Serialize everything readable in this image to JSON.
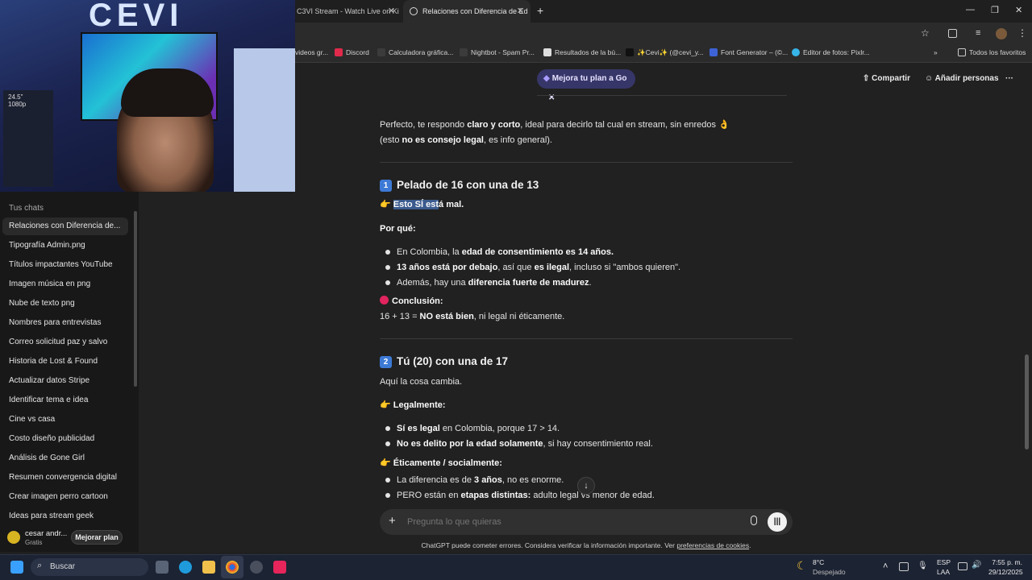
{
  "browser": {
    "tabs": [
      {
        "title": "C3VI Stream - Watch Live on Ki"
      },
      {
        "title": "Relaciones con Diferencia de Ed"
      }
    ],
    "new_tab": "+",
    "bookmarks": [
      "videos gr...",
      "Discord",
      "Calculadora gráfica...",
      "Nightbot - Spam Pr...",
      "Resultados de la bú...",
      "✨Cevi✨ (@cevi_y...",
      "Font Generator – (©...",
      "Editor de fotos: Pixlr...",
      "Todos los favoritos"
    ],
    "overflow": "»"
  },
  "webcam": {
    "sign_text": "CEVI",
    "monitor_text": "24.5\" 1080p"
  },
  "sidebar": {
    "header": "Tus chats",
    "items": [
      "Relaciones con Diferencia de...",
      "Tipografía Admin.png",
      "Títulos impactantes YouTube",
      "Imagen música en png",
      "Nube de texto png",
      "Nombres para entrevistas",
      "Correo solicitud paz y salvo",
      "Historia de Lost & Found",
      "Actualizar datos Stripe",
      "Identificar tema e idea",
      "Cine vs casa",
      "Costo diseño publicidad",
      "Análisis de Gone Girl",
      "Resumen convergencia digital",
      "Crear imagen perro cartoon",
      "Ideas para stream geek"
    ],
    "user": {
      "name": "cesar andr...",
      "plan": "Gratis",
      "upgrade": "Mejorar plan"
    }
  },
  "topbar": {
    "upgrade_pill": "Mejora tu plan a Go",
    "share": "Compartir",
    "add_people": "Añadir personas"
  },
  "message": {
    "intro_1a": "Perfecto, te respondo ",
    "intro_1b": "claro y corto",
    "intro_1c": ", ideal para decirlo tal cual en stream, sin enredos 👌",
    "intro_2a": "(esto ",
    "intro_2b": "no es consejo legal",
    "intro_2c": ", es info general).",
    "s1_num": "1",
    "s1_title": "Pelado de 16 con una de 13",
    "s1_emoji": "👉",
    "s1_verdict_hl": "Esto SÍ est",
    "s1_verdict_rest": "á mal.",
    "s1_why": "Por qué:",
    "s1_b1a": "En Colombia, la ",
    "s1_b1b": "edad de consentimiento es 14 años.",
    "s1_b2a": "13 años está por debajo",
    "s1_b2b": ", así que ",
    "s1_b2c": "es ilegal",
    "s1_b2d": ", incluso si \"ambos quieren\".",
    "s1_b3a": "Además, hay una ",
    "s1_b3b": "diferencia fuerte de madurez",
    "s1_b3c": ".",
    "s1_concl": "Conclusión:",
    "s1_concl_a": "16 + 13 = ",
    "s1_concl_b": "NO está bien",
    "s1_concl_c": ", ni legal ni éticamente.",
    "s2_num": "2",
    "s2_title": "Tú (20) con una de 17",
    "s2_intro": "Aquí la cosa cambia.",
    "s2_legal": "Legalmente:",
    "s2_b1a": "Sí es legal",
    "s2_b1b": " en Colombia, porque 17 > 14.",
    "s2_b2a": "No es delito por la edad solamente",
    "s2_b2b": ", si hay consentimiento real.",
    "s2_ethic": "Éticamente / socialmente:",
    "s2_b3a": "La diferencia es de ",
    "s2_b3b": "3 años",
    "s2_b3c": ", no es enorme.",
    "s2_b4a": "PERO están en ",
    "s2_b4b": "etapas distintas:",
    "s2_b4c": " adulto legal vs menor de edad."
  },
  "composer": {
    "placeholder": "Pregunta lo que quieras"
  },
  "disclaimer": {
    "text": "ChatGPT puede cometer errores. Considera verificar la información importante. Ver ",
    "link": "preferencias de cookies",
    "end": "."
  },
  "taskbar": {
    "search": "Buscar",
    "weather_temp": "8°C",
    "weather_desc": "Despejado",
    "lang_1": "ESP",
    "lang_2": "LAA",
    "time": "7:55 p. m.",
    "date": "29/12/2025"
  },
  "colors": {
    "accent_pill": "#373669",
    "number_badge": "#3d7ad6",
    "conclusion_dot": "#e0245e"
  }
}
